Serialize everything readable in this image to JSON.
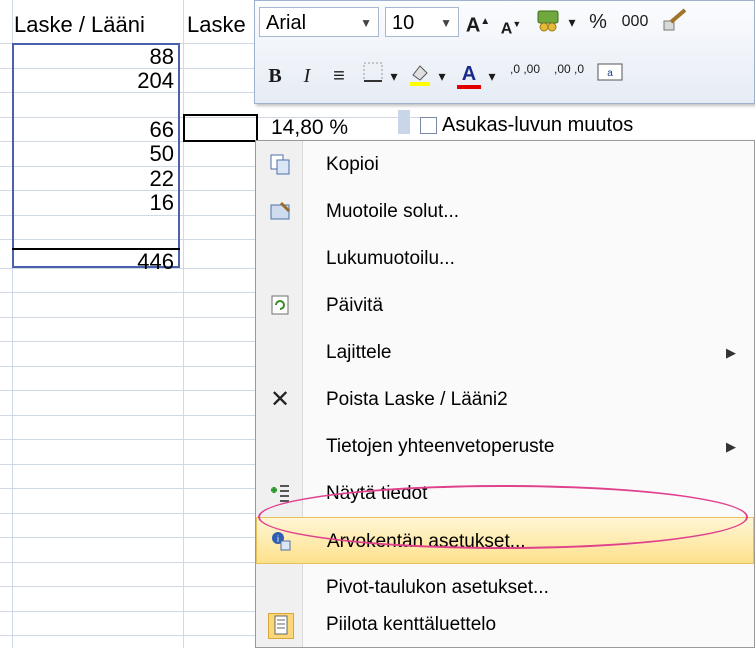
{
  "sheet": {
    "headers": [
      "Laske / Lääni",
      "Laske"
    ],
    "values": [
      "88",
      "204",
      "66",
      "50",
      "22",
      "16",
      "446"
    ],
    "active_cell_value": "14,80 %",
    "field_list_item": "Asukas-luvun muutos"
  },
  "minibar": {
    "font_name": "Arial",
    "font_size": "10",
    "grow_font": "A",
    "shrink_font": "A",
    "percent": "%",
    "thousands": "000",
    "bold": "B",
    "italic": "I",
    "font_color_letter": "A",
    "increase_decimal": ",0 ,00",
    "decrease_decimal": ",00 ,0"
  },
  "menu": {
    "items": [
      {
        "label": "Kopioi",
        "icon": "copy-icon",
        "submenu": false
      },
      {
        "label": "Muotoile solut...",
        "icon": "format-cells-icon",
        "submenu": false
      },
      {
        "label": "Lukumuotoilu...",
        "icon": "",
        "submenu": false
      },
      {
        "label": "Päivitä",
        "icon": "refresh-icon",
        "submenu": false
      },
      {
        "label": "Lajittele",
        "icon": "",
        "submenu": true
      },
      {
        "label": "Poista Laske / Lääni2",
        "icon": "remove-icon",
        "submenu": false
      },
      {
        "label": "Tietojen yhteenvetoperuste",
        "icon": "",
        "submenu": true
      },
      {
        "label": "Näytä tiedot",
        "icon": "show-details-icon",
        "submenu": false
      },
      {
        "label": "Arvokentän asetukset...",
        "icon": "value-field-settings-icon",
        "submenu": false,
        "highlighted": true
      },
      {
        "label": "Pivot-taulukon asetukset...",
        "icon": "",
        "submenu": false
      },
      {
        "label": "Piilota kenttäluettelo",
        "icon": "field-list-icon",
        "submenu": false
      }
    ]
  },
  "colors": {
    "selection_border": "#4a62ad",
    "highlight_ellipse": "#e0418d",
    "menu_highlight": "#fde18c"
  }
}
